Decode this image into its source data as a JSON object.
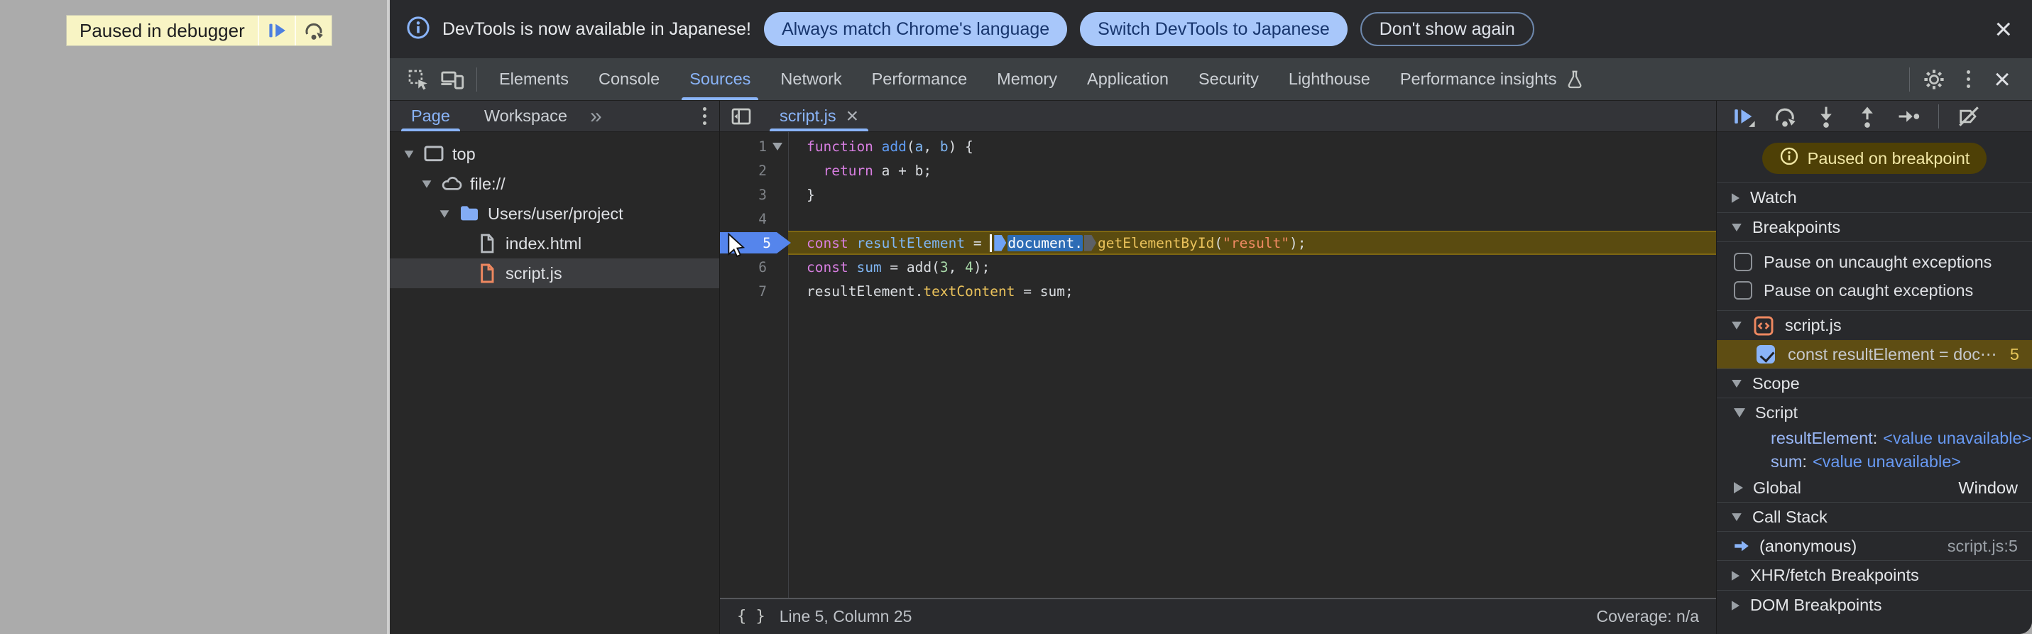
{
  "overlay": {
    "label": "Paused in debugger"
  },
  "notification": {
    "text": "DevTools is now available in Japanese!",
    "primary_actions": [
      "Always match Chrome's language",
      "Switch DevTools to Japanese"
    ],
    "dismiss_action": "Don't show again",
    "close_glyph": "×"
  },
  "main_tabs": {
    "items": [
      "Elements",
      "Console",
      "Sources",
      "Network",
      "Performance",
      "Memory",
      "Application",
      "Security",
      "Lighthouse",
      "Performance insights"
    ],
    "active": "Sources"
  },
  "navigator": {
    "tabs": [
      "Page",
      "Workspace"
    ],
    "active_tab": "Page",
    "overflow_glyph": "»",
    "tree": [
      {
        "label": "top",
        "icon": "frame",
        "depth": 0,
        "expanded": true
      },
      {
        "label": "file://",
        "icon": "cloud",
        "depth": 1,
        "expanded": true
      },
      {
        "label": "Users/user/project",
        "icon": "folder",
        "depth": 2,
        "expanded": true
      },
      {
        "label": "index.html",
        "icon": "file",
        "depth": 3
      },
      {
        "label": "script.js",
        "icon": "file-js",
        "depth": 3,
        "selected": true
      }
    ]
  },
  "editor": {
    "tab": "script.js",
    "tab_close_glyph": "×",
    "brace_glyph": "{ }",
    "status_position": "Line 5, Column 25",
    "status_coverage": "Coverage: n/a",
    "lines": [
      {
        "num": 1,
        "fold": true,
        "tokens": [
          {
            "s": "kw",
            "t": "function"
          },
          {
            "s": "pl",
            "t": " "
          },
          {
            "s": "fn",
            "t": "add"
          },
          {
            "s": "pl",
            "t": "("
          },
          {
            "s": "var",
            "t": "a"
          },
          {
            "s": "pl",
            "t": ", "
          },
          {
            "s": "var",
            "t": "b"
          },
          {
            "s": "pl",
            "t": ") {"
          }
        ]
      },
      {
        "num": 2,
        "tokens": [
          {
            "s": "pl",
            "t": "  "
          },
          {
            "s": "kw",
            "t": "return"
          },
          {
            "s": "pl",
            "t": " a + b;"
          }
        ]
      },
      {
        "num": 3,
        "tokens": [
          {
            "s": "pl",
            "t": "}"
          }
        ]
      },
      {
        "num": 4,
        "tokens": []
      },
      {
        "num": 5,
        "exec": true,
        "tokens": [
          {
            "s": "kw",
            "t": "const"
          },
          {
            "s": "pl",
            "t": " "
          },
          {
            "s": "var",
            "t": "resultElement"
          },
          {
            "s": "pl",
            "t": " = "
          },
          {
            "caret": true
          },
          {
            "marker": "blue"
          },
          {
            "s": "sel",
            "t": "document."
          },
          {
            "marker": "gray"
          },
          {
            "s": "prop",
            "t": "getElementById"
          },
          {
            "s": "pl",
            "t": "("
          },
          {
            "s": "str",
            "t": "\"result\""
          },
          {
            "s": "pl",
            "t": ");"
          }
        ]
      },
      {
        "num": 6,
        "tokens": [
          {
            "s": "kw",
            "t": "const"
          },
          {
            "s": "pl",
            "t": " "
          },
          {
            "s": "var",
            "t": "sum"
          },
          {
            "s": "pl",
            "t": " = add("
          },
          {
            "s": "num",
            "t": "3"
          },
          {
            "s": "pl",
            "t": ", "
          },
          {
            "s": "num",
            "t": "4"
          },
          {
            "s": "pl",
            "t": ");"
          }
        ]
      },
      {
        "num": 7,
        "tokens": [
          {
            "s": "pl",
            "t": "resultElement."
          },
          {
            "s": "prop",
            "t": "textContent"
          },
          {
            "s": "pl",
            "t": " = sum;"
          }
        ]
      }
    ]
  },
  "debugger": {
    "toolbar_icons": [
      "resume",
      "step-over",
      "step-into",
      "step-out",
      "step",
      "deactivate-breakpoints"
    ],
    "paused_pill": "Paused on breakpoint",
    "watch_label": "Watch",
    "breakpoints_label": "Breakpoints",
    "exception_toggles": [
      {
        "label": "Pause on uncaught exceptions",
        "checked": false
      },
      {
        "label": "Pause on caught exceptions",
        "checked": false
      }
    ],
    "breakpoint_group": {
      "file": "script.js",
      "entries": [
        {
          "code": "const resultElement = doc⋯",
          "line": "5",
          "checked": true
        }
      ]
    },
    "scope_label": "Scope",
    "scope_script_label": "Script",
    "scope_vars": [
      {
        "name": "resultElement",
        "value": "<value unavailable>"
      },
      {
        "name": "sum",
        "value": "<value unavailable>"
      }
    ],
    "scope_global": {
      "label": "Global",
      "value": "Window"
    },
    "call_stack_label": "Call Stack",
    "frames": [
      {
        "name": "(anonymous)",
        "location": "script.js:5"
      }
    ],
    "xhr_label": "XHR/fetch Breakpoints",
    "dom_label": "DOM Breakpoints"
  },
  "colors": {
    "accent_blue": "#8ab4f8",
    "notification_pill_bg": "#a8c7fa",
    "notification_pill_text": "#17356d",
    "paused_line_bg": "#5a4b10",
    "exec_badge_bg": "#5585ec",
    "selection_bg": "#2d6cb5",
    "paused_pill_bg": "#4e4006",
    "paused_pill_text": "#f2e8a6",
    "js_file_orange": "#ee8860",
    "banner_bg": "#f8f4c4"
  }
}
